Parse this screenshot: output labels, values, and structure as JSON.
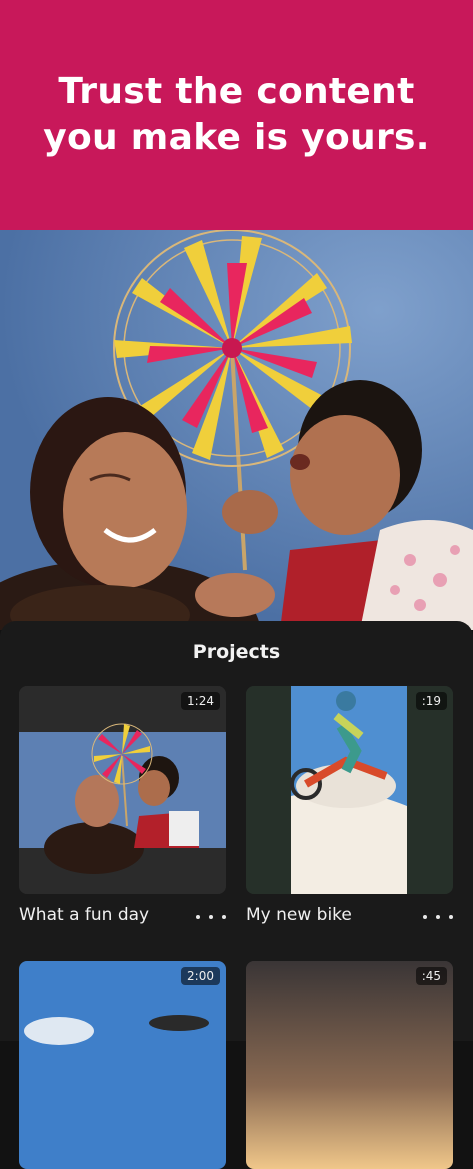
{
  "hero": {
    "title_line1": "Trust the content",
    "title_line2": "you make is yours.",
    "background_color": "#c8185a"
  },
  "projects": {
    "heading": "Projects",
    "items": [
      {
        "title": "What a fun day",
        "duration": "1:24"
      },
      {
        "title": "My new bike",
        "duration": ":19"
      },
      {
        "title": "",
        "duration": "2:00"
      },
      {
        "title": "",
        "duration": ":45"
      }
    ]
  },
  "icons": {
    "more": "more-horizontal-icon"
  }
}
